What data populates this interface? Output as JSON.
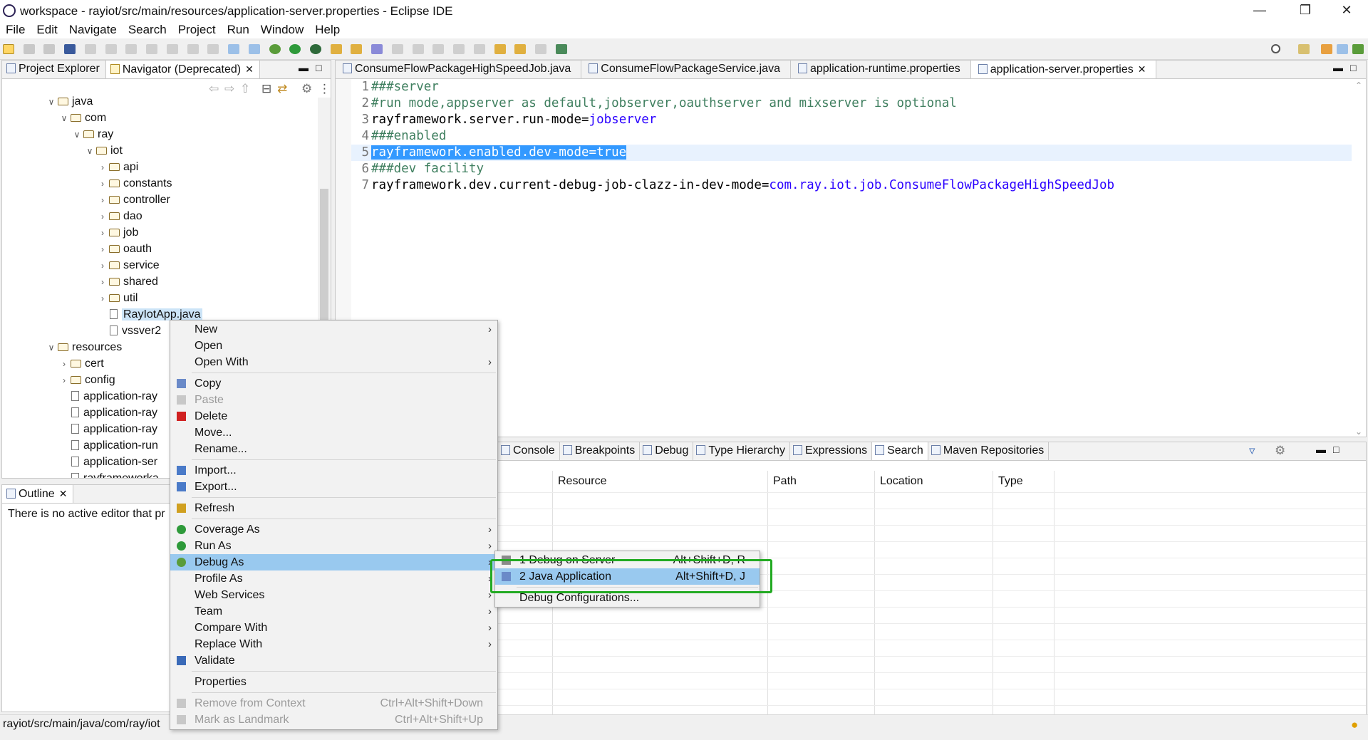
{
  "window": {
    "title": "workspace - rayiot/src/main/resources/application-server.properties - Eclipse IDE"
  },
  "menubar": [
    "File",
    "Edit",
    "Navigate",
    "Search",
    "Project",
    "Run",
    "Window",
    "Help"
  ],
  "left_tabs": [
    {
      "label": "Project Explorer"
    },
    {
      "label": "Navigator (Deprecated)"
    }
  ],
  "tree": [
    {
      "indent": 0,
      "type": "folder",
      "label": "java",
      "arrow": "v"
    },
    {
      "indent": 1,
      "type": "folder",
      "label": "com",
      "arrow": "v"
    },
    {
      "indent": 2,
      "type": "folder",
      "label": "ray",
      "arrow": "v"
    },
    {
      "indent": 3,
      "type": "folder",
      "label": "iot",
      "arrow": "v"
    },
    {
      "indent": 4,
      "type": "folder",
      "label": "api",
      "arrow": ">"
    },
    {
      "indent": 4,
      "type": "folder",
      "label": "constants",
      "arrow": ">"
    },
    {
      "indent": 4,
      "type": "folder",
      "label": "controller",
      "arrow": ">"
    },
    {
      "indent": 4,
      "type": "folder",
      "label": "dao",
      "arrow": ">"
    },
    {
      "indent": 4,
      "type": "folder",
      "label": "job",
      "arrow": ">"
    },
    {
      "indent": 4,
      "type": "folder",
      "label": "oauth",
      "arrow": ">"
    },
    {
      "indent": 4,
      "type": "folder",
      "label": "service",
      "arrow": ">"
    },
    {
      "indent": 4,
      "type": "folder",
      "label": "shared",
      "arrow": ">"
    },
    {
      "indent": 4,
      "type": "folder",
      "label": "util",
      "arrow": ">"
    },
    {
      "indent": 4,
      "type": "file",
      "label": "RayIotApp.java",
      "arrow": "",
      "selected": true
    },
    {
      "indent": 4,
      "type": "file",
      "label": "vssver2",
      "arrow": ""
    },
    {
      "indent": 0,
      "type": "folder",
      "label": "resources",
      "arrow": "v"
    },
    {
      "indent": 1,
      "type": "folder",
      "label": "cert",
      "arrow": ">"
    },
    {
      "indent": 1,
      "type": "folder",
      "label": "config",
      "arrow": ">"
    },
    {
      "indent": 1,
      "type": "file",
      "label": "application-ray",
      "arrow": ""
    },
    {
      "indent": 1,
      "type": "file",
      "label": "application-ray",
      "arrow": ""
    },
    {
      "indent": 1,
      "type": "file",
      "label": "application-ray",
      "arrow": ""
    },
    {
      "indent": 1,
      "type": "file",
      "label": "application-run",
      "arrow": ""
    },
    {
      "indent": 1,
      "type": "file",
      "label": "application-ser",
      "arrow": ""
    },
    {
      "indent": 1,
      "type": "file",
      "label": "rayframeworka",
      "arrow": ""
    }
  ],
  "outline": {
    "tab_label": "Outline",
    "message": "There is no active editor that pr"
  },
  "editor_tabs": [
    {
      "label": "ConsumeFlowPackageHighSpeedJob.java",
      "active": false
    },
    {
      "label": "ConsumeFlowPackageService.java",
      "active": false
    },
    {
      "label": "application-runtime.properties",
      "active": false
    },
    {
      "label": "application-server.properties",
      "active": true
    }
  ],
  "code": [
    {
      "n": "1",
      "parts": [
        {
          "t": "###server",
          "c": "cmt"
        }
      ]
    },
    {
      "n": "2",
      "parts": [
        {
          "t": "#run mode,appserver as default,jobserver,oauthserver and mixserver is optional",
          "c": "cmt"
        }
      ]
    },
    {
      "n": "3",
      "parts": [
        {
          "t": "rayframework.server.run-mode=",
          "c": "key"
        },
        {
          "t": "jobserver",
          "c": "val"
        }
      ]
    },
    {
      "n": "4",
      "parts": [
        {
          "t": "###enabled",
          "c": "cmt"
        }
      ]
    },
    {
      "n": "5",
      "parts": [
        {
          "t": "rayframework.enabled.dev-mode=true",
          "c": "sel"
        }
      ],
      "current": true
    },
    {
      "n": "6",
      "parts": [
        {
          "t": "###dev facility",
          "c": "cmt"
        }
      ]
    },
    {
      "n": "7",
      "parts": [
        {
          "t": "rayframework.dev.current-debug-job-clazz-in-dev-mode=",
          "c": "key"
        },
        {
          "t": "com.ray.iot.job.ConsumeFlowPackageHighSpeedJob",
          "c": "val"
        }
      ]
    }
  ],
  "bottom_tabs": [
    "Console",
    "Breakpoints",
    "Debug",
    "Type Hierarchy",
    "Expressions",
    "Search",
    "Maven Repositories"
  ],
  "bottom_table": {
    "columns": [
      "Resource",
      "Path",
      "Location",
      "Type"
    ]
  },
  "context_menu": [
    {
      "label": "New",
      "sub": true
    },
    {
      "label": "Open"
    },
    {
      "label": "Open With",
      "sub": true
    },
    {
      "sep": true
    },
    {
      "label": "Copy",
      "icon": "copy-icon"
    },
    {
      "label": "Paste",
      "icon": "paste-icon",
      "disabled": true
    },
    {
      "label": "Delete",
      "icon": "delete-icon"
    },
    {
      "label": "Move..."
    },
    {
      "label": "Rename..."
    },
    {
      "sep": true
    },
    {
      "label": "Import...",
      "icon": "import-icon"
    },
    {
      "label": "Export...",
      "icon": "export-icon"
    },
    {
      "sep": true
    },
    {
      "label": "Refresh",
      "icon": "refresh-icon"
    },
    {
      "sep": true
    },
    {
      "label": "Coverage As",
      "icon": "coverage-icon",
      "sub": true
    },
    {
      "label": "Run As",
      "icon": "run-icon",
      "sub": true
    },
    {
      "label": "Debug As",
      "icon": "debug-icon",
      "sub": true,
      "highlight": true
    },
    {
      "label": "Profile As",
      "sub": true
    },
    {
      "label": "Web Services",
      "sub": true
    },
    {
      "label": "Team",
      "sub": true
    },
    {
      "label": "Compare With",
      "sub": true
    },
    {
      "label": "Replace With",
      "sub": true
    },
    {
      "label": "Validate",
      "icon": "check-icon"
    },
    {
      "sep": true
    },
    {
      "label": "Properties"
    },
    {
      "sep": true
    },
    {
      "label": "Remove from Context",
      "icon": "context-icon",
      "disabled": true,
      "accel": "Ctrl+Alt+Shift+Down"
    },
    {
      "label": "Mark as Landmark",
      "icon": "landmark-icon",
      "disabled": true,
      "accel": "Ctrl+Alt+Shift+Up"
    }
  ],
  "submenu": [
    {
      "label": "1 Debug on Server",
      "accel": "Alt+Shift+D, R",
      "icon": "server-icon"
    },
    {
      "label": "2 Java Application",
      "accel": "Alt+Shift+D, J",
      "icon": "java-app-icon",
      "highlight": true
    },
    {
      "sep": true
    },
    {
      "label": "Debug Configurations..."
    }
  ],
  "statusbar": {
    "path": "rayiot/src/main/java/com/ray/iot"
  },
  "colors": {
    "highlight": "#99c9ef",
    "callout": "#22aa22",
    "selection": "#3399ff",
    "comment": "#3f7f5f",
    "value": "#2a00ff"
  }
}
